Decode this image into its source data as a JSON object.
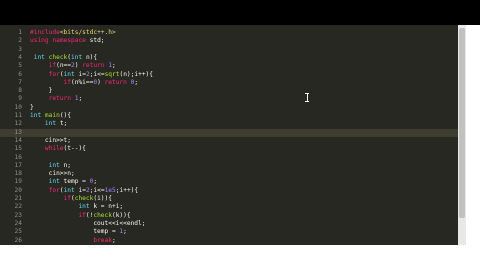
{
  "editor": {
    "lines": [
      {
        "n": "1",
        "t": [
          [
            "#include",
            "kw"
          ],
          [
            "<bits/stdc++.h>",
            "str"
          ]
        ]
      },
      {
        "n": "2",
        "t": [
          [
            "using",
            "kw"
          ],
          [
            " ",
            "pl"
          ],
          [
            "namespace",
            "kw"
          ],
          [
            " std;",
            "pl"
          ]
        ]
      },
      {
        "n": "3",
        "t": []
      },
      {
        "n": "4",
        "t": [
          [
            " ",
            "pl"
          ],
          [
            "int",
            "ty"
          ],
          [
            " ",
            "pl"
          ],
          [
            "check",
            "fn"
          ],
          [
            "(",
            "pl"
          ],
          [
            "int",
            "ty"
          ],
          [
            " n){",
            "pl"
          ]
        ]
      },
      {
        "n": "5",
        "t": [
          [
            "     ",
            "pl"
          ],
          [
            "if",
            "kw"
          ],
          [
            "(n==",
            "pl"
          ],
          [
            "2",
            "num"
          ],
          [
            ") ",
            "pl"
          ],
          [
            "return",
            "kw"
          ],
          [
            " ",
            "pl"
          ],
          [
            "1",
            "num"
          ],
          [
            ";",
            "pl"
          ]
        ]
      },
      {
        "n": "6",
        "t": [
          [
            "     ",
            "pl"
          ],
          [
            "for",
            "kw"
          ],
          [
            "(",
            "pl"
          ],
          [
            "int",
            "ty"
          ],
          [
            " i=",
            "pl"
          ],
          [
            "2",
            "num"
          ],
          [
            ";i<=",
            "pl"
          ],
          [
            "sqrt",
            "fn"
          ],
          [
            "(n);i++){",
            "pl"
          ]
        ]
      },
      {
        "n": "7",
        "t": [
          [
            "         ",
            "pl"
          ],
          [
            "if",
            "kw"
          ],
          [
            "(n%i==",
            "pl"
          ],
          [
            "0",
            "num"
          ],
          [
            ") ",
            "pl"
          ],
          [
            "return",
            "kw"
          ],
          [
            " ",
            "pl"
          ],
          [
            "0",
            "num"
          ],
          [
            ";",
            "pl"
          ]
        ]
      },
      {
        "n": "8",
        "t": [
          [
            "     }",
            "pl"
          ]
        ]
      },
      {
        "n": "9",
        "t": [
          [
            "     ",
            "pl"
          ],
          [
            "return",
            "kw"
          ],
          [
            " ",
            "pl"
          ],
          [
            "1",
            "num"
          ],
          [
            ";",
            "pl"
          ]
        ]
      },
      {
        "n": "10",
        "t": [
          [
            "}",
            "pl"
          ]
        ]
      },
      {
        "n": "11",
        "t": [
          [
            "int",
            "ty"
          ],
          [
            " ",
            "pl"
          ],
          [
            "main",
            "fn"
          ],
          [
            "(){",
            "pl"
          ]
        ]
      },
      {
        "n": "12",
        "t": [
          [
            "    ",
            "pl"
          ],
          [
            "int",
            "ty"
          ],
          [
            " t;",
            "pl"
          ]
        ]
      },
      {
        "n": "13",
        "t": [],
        "current": true
      },
      {
        "n": "14",
        "t": [
          [
            "    cin>>t;",
            "pl"
          ]
        ]
      },
      {
        "n": "15",
        "t": [
          [
            "    ",
            "pl"
          ],
          [
            "while",
            "kw"
          ],
          [
            "(t--){",
            "pl"
          ]
        ]
      },
      {
        "n": "16",
        "t": []
      },
      {
        "n": "17",
        "t": [
          [
            "     ",
            "pl"
          ],
          [
            "int",
            "ty"
          ],
          [
            " n;",
            "pl"
          ]
        ]
      },
      {
        "n": "18",
        "t": [
          [
            "     cin>>n;",
            "pl"
          ]
        ]
      },
      {
        "n": "19",
        "t": [
          [
            "     ",
            "pl"
          ],
          [
            "int",
            "ty"
          ],
          [
            " temp = ",
            "pl"
          ],
          [
            "0",
            "num"
          ],
          [
            ";",
            "pl"
          ]
        ]
      },
      {
        "n": "20",
        "t": [
          [
            "     ",
            "pl"
          ],
          [
            "for",
            "kw"
          ],
          [
            "(",
            "pl"
          ],
          [
            "int",
            "ty"
          ],
          [
            " i=",
            "pl"
          ],
          [
            "2",
            "num"
          ],
          [
            ";i<=",
            "pl"
          ],
          [
            "1e5",
            "num"
          ],
          [
            ";i++){",
            "pl"
          ]
        ]
      },
      {
        "n": "21",
        "t": [
          [
            "         ",
            "pl"
          ],
          [
            "if",
            "kw"
          ],
          [
            "(",
            "pl"
          ],
          [
            "check",
            "fn"
          ],
          [
            "(i)){",
            "pl"
          ]
        ]
      },
      {
        "n": "22",
        "t": [
          [
            "             ",
            "pl"
          ],
          [
            "int",
            "ty"
          ],
          [
            " k = n+i;",
            "pl"
          ]
        ]
      },
      {
        "n": "23",
        "t": [
          [
            "             ",
            "pl"
          ],
          [
            "if",
            "kw"
          ],
          [
            "(!",
            "pl"
          ],
          [
            "check",
            "fn"
          ],
          [
            "(k)){",
            "pl"
          ]
        ]
      },
      {
        "n": "24",
        "t": [
          [
            "                 cout<<i<<endl;",
            "pl"
          ]
        ]
      },
      {
        "n": "25",
        "t": [
          [
            "                 temp = ",
            "pl"
          ],
          [
            "1",
            "num"
          ],
          [
            ";",
            "pl"
          ]
        ]
      },
      {
        "n": "26",
        "t": [
          [
            "                 ",
            "pl"
          ],
          [
            "break",
            "kw"
          ],
          [
            ";",
            "pl"
          ]
        ]
      }
    ]
  },
  "icons": {
    "cursor": "i-beam-cursor-icon"
  },
  "colors": {
    "background": "#272822",
    "keyword": "#f92672",
    "type": "#66d9ef",
    "function": "#a6e22e",
    "number": "#ae81ff",
    "string": "#e6db74",
    "text": "#f8f8f2",
    "line_number": "#8f908a",
    "current_line": "#3e3d32"
  }
}
